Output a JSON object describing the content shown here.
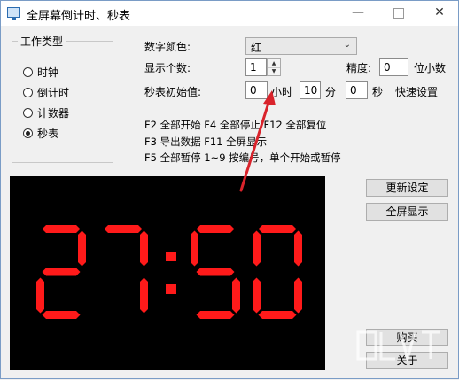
{
  "window": {
    "title": "全屏幕倒计时、秒表",
    "min_glyph": "—",
    "close_glyph": "✕"
  },
  "type_group": {
    "legend": "工作类型",
    "options": [
      {
        "label": "时钟",
        "checked": false
      },
      {
        "label": "倒计时",
        "checked": false
      },
      {
        "label": "计数器",
        "checked": false
      },
      {
        "label": "秒表",
        "checked": true
      }
    ]
  },
  "settings": {
    "color_label": "数字颜色:",
    "color_value": "红",
    "count_label": "显示个数:",
    "count_value": "1",
    "precision_label": "精度:",
    "precision_value": "0",
    "precision_unit": "位小数",
    "initial_label": "秒表初始值:",
    "hours_value": "0",
    "hours_unit": "小时",
    "minutes_value": "10",
    "minutes_unit": "分",
    "seconds_value": "0",
    "seconds_unit": "秒",
    "quick_label": "快速设置"
  },
  "hints": [
    "F2 全部开始 F4 全部停止 F12 全部复位",
    "F3 导出数据 F11 全屏显示",
    "F5 全部暂停 1~9 按编号，单个开始或暂停"
  ],
  "buttons": {
    "update": "更新设定",
    "fullscreen": "全屏显示",
    "buy": "购买",
    "about": "关于"
  },
  "display": {
    "text": "27:50",
    "digit_color": "#ff1a1a",
    "background": "#000000"
  },
  "annotation_color": "#d9232b"
}
